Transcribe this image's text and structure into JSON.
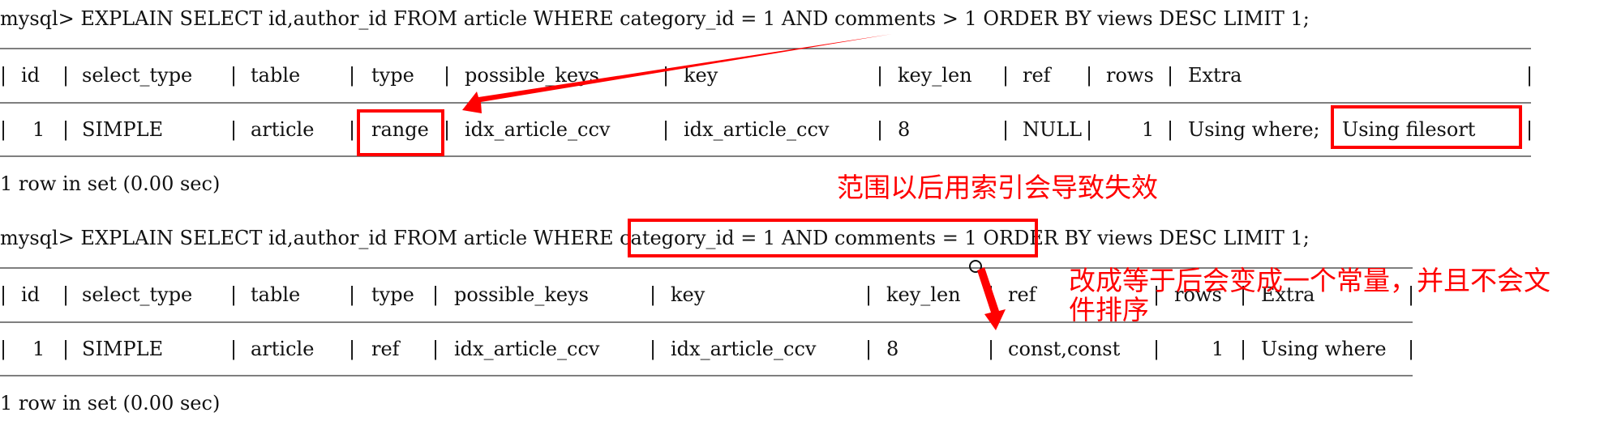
{
  "query1": {
    "prompt": "mysql>",
    "sql": "EXPLAIN SELECT id,author_id FROM article WHERE category_id = 1 AND comments > 1 ORDER BY views DESC LIMIT 1;",
    "columns": [
      "id",
      "select_type",
      "table",
      "type",
      "possible_keys",
      "key",
      "key_len",
      "ref",
      "rows",
      "Extra"
    ],
    "row": [
      "1",
      "SIMPLE",
      "article",
      "range",
      "idx_article_ccv",
      "idx_article_ccv",
      "8",
      "NULL",
      "1",
      "Using where;",
      "Using filesort"
    ],
    "footer": "1 row in set (0.00 sec)"
  },
  "query2": {
    "prompt": "mysql>",
    "sql": "EXPLAIN SELECT id,author_id FROM article WHERE category_id = 1 AND comments = 1 ORDER BY views DESC LIMIT 1;",
    "columns": [
      "id",
      "select_type",
      "table",
      "type",
      "possible_keys",
      "key",
      "key_len",
      "ref",
      "rows",
      "Extra"
    ],
    "row": [
      "1",
      "SIMPLE",
      "article",
      "ref",
      "idx_article_ccv",
      "idx_article_ccv",
      "8",
      "const,const",
      "1",
      "Using where"
    ],
    "footer": "1 row in set (0.00 sec)"
  },
  "annotations": {
    "note1": "范围以后用索引会导致失效",
    "note2_line1": "改成等于后会变成一个常量，并且不会文",
    "note2_line2": "件排序"
  },
  "colors": {
    "highlight": "#ff0000",
    "text": "#111111",
    "background": "#ffffff"
  }
}
